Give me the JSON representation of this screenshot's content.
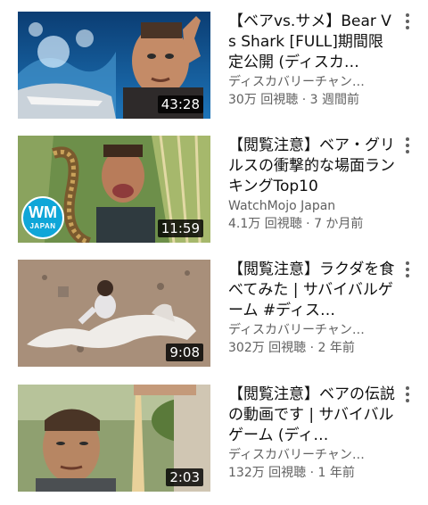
{
  "videos": [
    {
      "title": "【ベアvs.サメ】Bear Vs Shark [FULL]期間限定公開 (ディスカ…",
      "channel": "ディスカバリーチャン…",
      "stats": "30万 回視聴 · 3 週間前",
      "duration": "43:28"
    },
    {
      "title": "【閲覧注意】ベア・グリルスの衝撃的な場面ランキングTop10",
      "channel": "WatchMojo Japan",
      "stats": "4.1万 回視聴 · 7 か月前",
      "duration": "11:59",
      "logo": {
        "main": "WM",
        "sub": "JAPAN"
      }
    },
    {
      "title": "【閲覧注意】ラクダを食べてみた | サバイバルゲーム #ディス…",
      "channel": "ディスカバリーチャン…",
      "stats": "302万 回視聴 · 2 年前",
      "duration": "9:08"
    },
    {
      "title": "【閲覧注意】ベアの伝説の動画です | サバイバルゲーム (ディ…",
      "channel": "ディスカバリーチャン…",
      "stats": "132万 回視聴 · 1 年前",
      "duration": "2:03"
    }
  ],
  "icons": {
    "menu": "more-vert-icon"
  }
}
